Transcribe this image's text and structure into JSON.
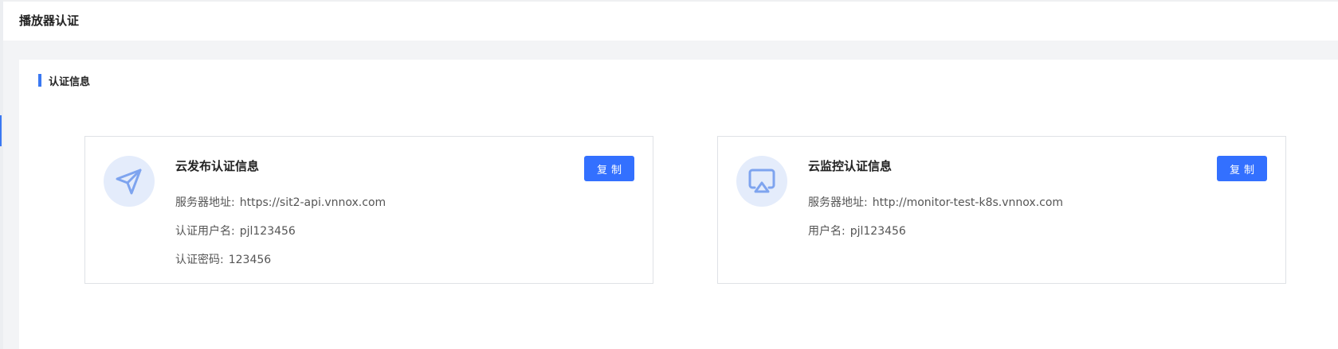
{
  "header": {
    "title": "播放器认证"
  },
  "section": {
    "title": "认证信息"
  },
  "cards": [
    {
      "title": "云发布认证信息",
      "icon": "send-icon",
      "copy_label": "复制",
      "rows": [
        {
          "label": "服务器地址:",
          "value": "https://sit2-api.vnnox.com"
        },
        {
          "label": "认证用户名:",
          "value": "pjl123456"
        },
        {
          "label": "认证密码:",
          "value": "123456"
        }
      ]
    },
    {
      "title": "云监控认证信息",
      "icon": "airplay-icon",
      "copy_label": "复制",
      "rows": [
        {
          "label": "服务器地址:",
          "value": "http://monitor-test-k8s.vnnox.com"
        },
        {
          "label": "用户名:",
          "value": "pjl123456"
        }
      ]
    }
  ],
  "colors": {
    "accent": "#3370ff",
    "icon": "#7ea4ef",
    "icon_bg": "#e4ecfb",
    "section_bar": "#3a78f2"
  }
}
